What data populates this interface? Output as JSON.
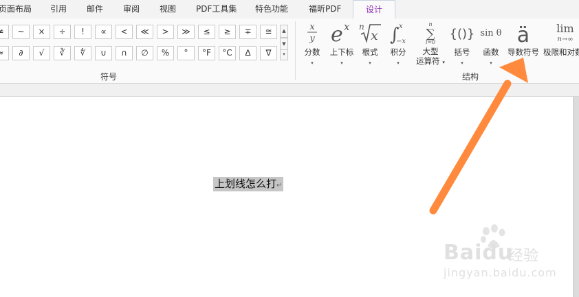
{
  "tabs": [
    {
      "label": "页面布局",
      "active": false
    },
    {
      "label": "引用",
      "active": false
    },
    {
      "label": "邮件",
      "active": false
    },
    {
      "label": "审阅",
      "active": false
    },
    {
      "label": "视图",
      "active": false
    },
    {
      "label": "PDF工具集",
      "active": false
    },
    {
      "label": "特色功能",
      "active": false
    },
    {
      "label": "福昕PDF",
      "active": false
    },
    {
      "label": "设计",
      "active": true
    }
  ],
  "symbols": {
    "group_label": "符号",
    "row1": [
      "≠",
      "~",
      "×",
      "÷",
      "!",
      "∝",
      "<",
      "≪",
      ">",
      "≫",
      "≤",
      "≥",
      "∓",
      "≅"
    ],
    "row2": [
      "≈",
      "∂",
      "√",
      "∛",
      "∜",
      "∪",
      "∩",
      "∅",
      "%",
      "°",
      "°F",
      "°C",
      "∆",
      "∇"
    ],
    "scroll_up": "▲",
    "scroll_down": "▼",
    "more": "▾"
  },
  "structures": {
    "group_label": "结构",
    "items": [
      {
        "id": "fraction",
        "icon": "x/y",
        "label": "分数"
      },
      {
        "id": "script",
        "icon": "eˣ",
        "label": "上下标"
      },
      {
        "id": "radical",
        "icon": "ⁿ√x",
        "label": "根式"
      },
      {
        "id": "integral",
        "icon": "∫",
        "label": "积分"
      },
      {
        "id": "large-operator",
        "icon": "∑",
        "label": "大型",
        "label2": "运算符"
      },
      {
        "id": "bracket",
        "icon": "{()}",
        "label": "括号"
      },
      {
        "id": "function",
        "icon": "sin θ",
        "label": "函数"
      },
      {
        "id": "accent",
        "icon": "ä",
        "label": "导数符号"
      },
      {
        "id": "limit-log",
        "icon": "lim",
        "label": "极限和对数"
      }
    ]
  },
  "document": {
    "text": "上划线怎么打",
    "paragraph_mark": "↵"
  },
  "watermark": {
    "logo": "Baidu",
    "cn": "经验",
    "url": "jingyan.baidu.com"
  },
  "colors": {
    "active_tab": "#8b2dad",
    "arrow": "#ff8a3d",
    "selection": "#c6c6c6"
  }
}
